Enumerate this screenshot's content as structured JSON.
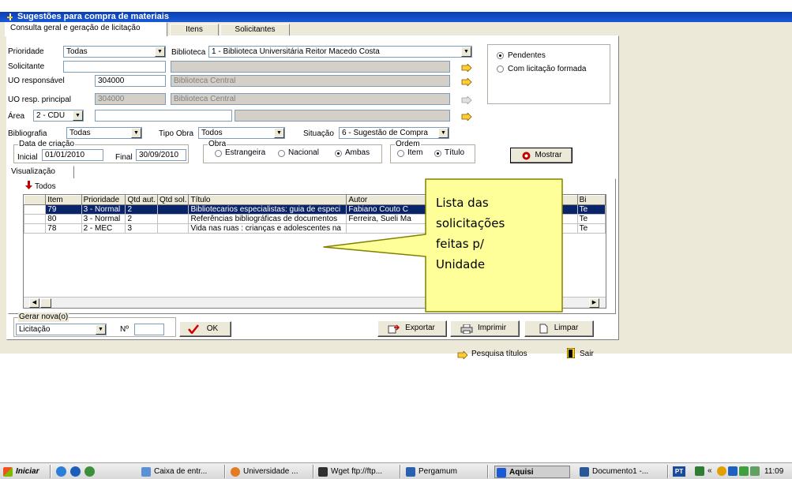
{
  "window": {
    "title": "Sugestões para compra de materiais"
  },
  "tabs": [
    "Consulta geral e geração de licitação",
    "Itens",
    "Solicitantes"
  ],
  "filters": {
    "prioridade_label": "Prioridade",
    "prioridade_value": "Todas",
    "biblioteca_label": "Biblioteca",
    "biblioteca_value": "1 - Biblioteca Universitária Reitor Macedo Costa",
    "solicitante_label": "Solicitante",
    "solicitante_value": "",
    "uo_label": "UO responsável",
    "uo_value": "304000",
    "uo_desc": "Biblioteca Central",
    "uo_principal_label": "UO resp. principal",
    "uo_principal_value": "304000",
    "uo_principal_desc": "Biblioteca Central",
    "area_label": "Área",
    "area_value": "2 - CDU",
    "bibliografia_label": "Bibliografia",
    "bibliografia_value": "Todas",
    "tipo_obra_label": "Tipo Obra",
    "tipo_obra_value": "Todos",
    "situacao_label": "Situação",
    "situacao_value": "6 - Sugestão de Compra"
  },
  "status_radios": {
    "pendentes": "Pendentes",
    "com_licitacao": "Com licitação formada",
    "selected": "pendentes"
  },
  "data_criacao": {
    "title": "Data de criação",
    "inicial_label": "Inicial",
    "inicial_value": "01/01/2010",
    "final_label": "Final",
    "final_value": "30/09/2010"
  },
  "obra": {
    "title": "Obra",
    "options": [
      "Estrangeira",
      "Nacional",
      "Ambas"
    ],
    "selected": "Ambas"
  },
  "ordem": {
    "title": "Ordem",
    "options": [
      "Item",
      "Título"
    ],
    "selected": "Título"
  },
  "mostrar_label": "Mostrar",
  "visualizacao_tab": "Visualização",
  "todos_label": "Todos",
  "grid": {
    "columns": [
      "Item",
      "Prioridade",
      "Qtd aut.",
      "Qtd sol.",
      "Título",
      "Autor",
      "Bi"
    ],
    "rows": [
      {
        "item": "79",
        "prioridade": "3 - Normal",
        "qtd_aut": "2",
        "qtd_sol": "",
        "titulo": "Bibliotecarios especialistas: guia de especi",
        "autor": "Fabiano Couto C",
        "bi": "Te"
      },
      {
        "item": "80",
        "prioridade": "3 - Normal",
        "qtd_aut": "2",
        "qtd_sol": "",
        "titulo": "Referências bibliográficas de documentos",
        "autor": "Ferreira, Sueli Ma",
        "bi": "Te"
      },
      {
        "item": "78",
        "prioridade": "2 - MEC",
        "qtd_aut": "3",
        "qtd_sol": "",
        "titulo": "Vida nas ruas : crianças e adolescentes na",
        "autor": "",
        "bi": "Te"
      }
    ]
  },
  "callout": {
    "text": "Lista das\nsolicitações\nfeitas p/\nUnidade"
  },
  "gerar": {
    "title": "Gerar nova(o)",
    "value": "Licitação",
    "numero_label": "Nº",
    "numero_value": "",
    "ok_label": "OK"
  },
  "actions": {
    "exportar": "Exportar",
    "imprimir": "Imprimir",
    "limpar": "Limpar"
  },
  "footer": {
    "pesquisa": "Pesquisa títulos",
    "sair": "Sair"
  },
  "taskbar": {
    "start": "Iniciar",
    "items": [
      "Caixa de entr...",
      "Universidade ...",
      "Wget ftp://ftp...",
      "Pergamum",
      "Aquisi",
      "Documento1 -..."
    ],
    "lang": "PT",
    "clock": "11:09"
  },
  "colors": {
    "title_bar": "#1b5ad6",
    "selection": "#0a246a",
    "callout_fill": "#ffff99"
  }
}
